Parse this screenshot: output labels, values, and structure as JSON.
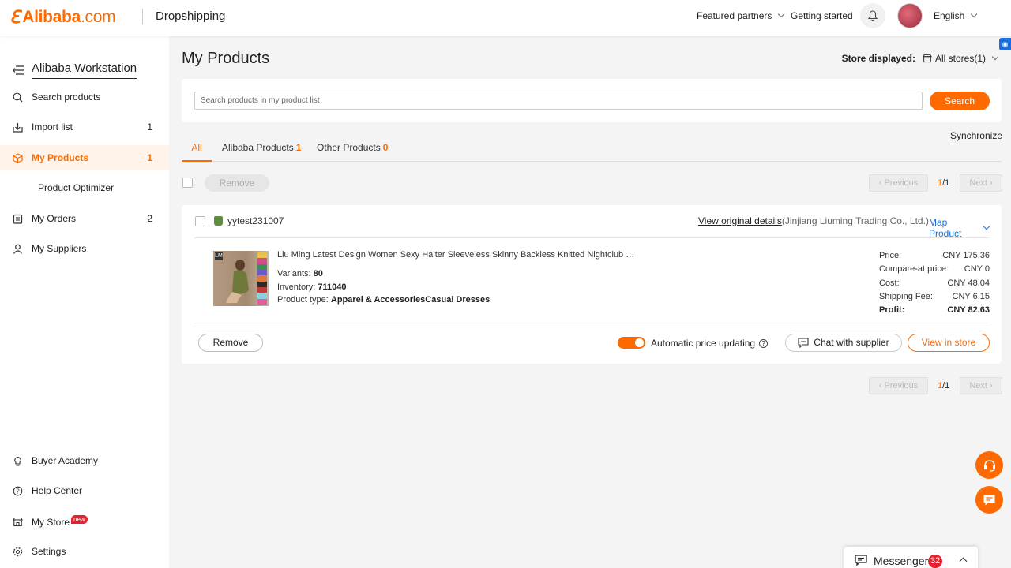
{
  "header": {
    "logo_text": "Alibaba",
    "logo_suffix": ".com",
    "section_title": "Dropshipping",
    "nav": {
      "featured_partners": "Featured partners",
      "getting_started": "Getting started",
      "language": "English"
    },
    "icons": {
      "logo": "alibaba-logo",
      "bell": "bell-icon",
      "avatar": "avatar"
    }
  },
  "sidebar": {
    "title": "Alibaba Workstation",
    "items": [
      {
        "label": "Search products",
        "icon": "search-icon",
        "count": ""
      },
      {
        "label": "Import list",
        "icon": "import-icon",
        "count": "1"
      },
      {
        "label": "My Products",
        "icon": "box-icon",
        "count": "1",
        "active": true
      },
      {
        "label": "Product Optimizer",
        "icon": "",
        "count": ""
      },
      {
        "label": "My Orders",
        "icon": "orders-icon",
        "count": "2"
      },
      {
        "label": "My Suppliers",
        "icon": "user-icon",
        "count": ""
      }
    ],
    "bottom_items": [
      {
        "label": "Buyer Academy",
        "icon": "lightbulb-icon"
      },
      {
        "label": "Help Center",
        "icon": "help-icon"
      },
      {
        "label": "My Store",
        "icon": "store-icon",
        "badge": "new"
      },
      {
        "label": "Settings",
        "icon": "gear-icon"
      }
    ]
  },
  "main": {
    "title": "My Products",
    "store_displayed_label": "Store displayed:",
    "store_displayed_value": "All stores(1)",
    "search": {
      "placeholder": "Search products in my product list",
      "button": "Search"
    },
    "synchronize": "Synchronize",
    "tabs": [
      {
        "label": "All",
        "count": ""
      },
      {
        "label": "Alibaba Products",
        "count": "1"
      },
      {
        "label": "Other Products",
        "count": "0"
      }
    ],
    "bulk_remove": "Remove",
    "pagination": {
      "previous": "Previous",
      "next": "Next",
      "current": "1",
      "total": "/1"
    }
  },
  "product": {
    "store_name": "yytest231007",
    "view_original": "View original details",
    "supplier": "(Jinjiang Liuming Trading Co., Ltd.)",
    "map_product": "Map Product",
    "title": "Liu Ming Latest Design Women Sexy Halter Sleeveless Skinny Backless Knitted Nightclub Dress",
    "variants_label": "Variants: ",
    "variants": "80",
    "inventory_label": "Inventory: ",
    "inventory": "711040",
    "type_label": "Product type: ",
    "type": "Apparel & AccessoriesCasual Dresses",
    "thumb_logo": "LM",
    "prices": [
      {
        "label": "Price:",
        "value": "CNY 175.36"
      },
      {
        "label": "Compare-at price:",
        "value": "CNY 0"
      },
      {
        "label": "Cost:",
        "value": "CNY 48.04"
      },
      {
        "label": "Shipping Fee:",
        "value": "CNY 6.15"
      },
      {
        "label": "Profit:",
        "value": "CNY 82.63",
        "bold": true
      }
    ],
    "remove": "Remove",
    "auto_price": "Automatic price updating",
    "auto_price_on": true,
    "chat": "Chat with supplier",
    "view_store": "View in store"
  },
  "messenger": {
    "label": "Messenger",
    "count": "32"
  },
  "colors": {
    "accent": "#ff6a00",
    "link_blue": "#1a6fe0",
    "badge_red": "#e6202e"
  }
}
